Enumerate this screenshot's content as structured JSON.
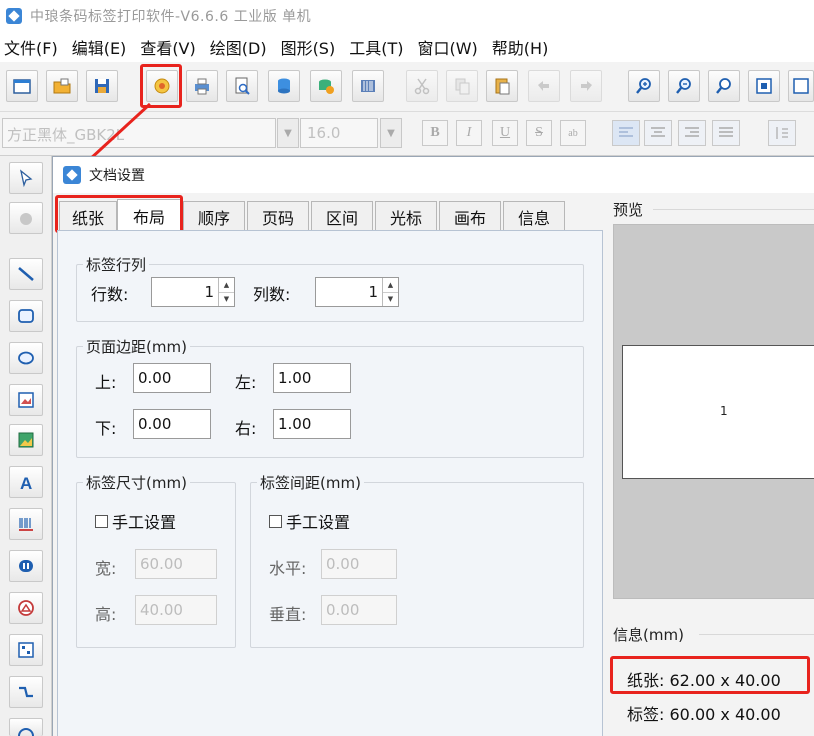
{
  "window": {
    "title": "中琅条码标签打印软件-V6.6.6 工业版 单机"
  },
  "menu": [
    "文件(F)",
    "编辑(E)",
    "查看(V)",
    "绘图(D)",
    "图形(S)",
    "工具(T)",
    "窗口(W)",
    "帮助(H)"
  ],
  "toolbar": {
    "buttons": [
      "new-icon",
      "open-icon",
      "save-icon",
      "document-settings-icon",
      "print-icon",
      "print-preview-icon",
      "database-icon",
      "data-source-icon",
      "barcode-icon",
      "cut-icon",
      "copy-icon",
      "paste-icon",
      "undo-icon",
      "redo-icon",
      "zoom-in-icon",
      "zoom-out-icon",
      "zoom-fit-icon",
      "zoom-page-icon",
      "more-icon"
    ],
    "highlighted": "document-settings-icon"
  },
  "font_toolbar": {
    "font_name": "方正黑体_GBK2L",
    "font_size": "16.0",
    "format_buttons": [
      "B",
      "I",
      "U",
      "S",
      "ab"
    ]
  },
  "dialog": {
    "title": "文档设置",
    "tabs": [
      "纸张",
      "布局",
      "顺序",
      "页码",
      "区间",
      "光标",
      "画布",
      "信息"
    ],
    "active_tab": "布局",
    "label_rows_cols": {
      "legend": "标签行列",
      "rows_label": "行数:",
      "rows_value": "1",
      "cols_label": "列数:",
      "cols_value": "1"
    },
    "page_margins": {
      "legend": "页面边距(mm)",
      "top_label": "上:",
      "top_value": "0.00",
      "left_label": "左:",
      "left_value": "1.00",
      "bottom_label": "下:",
      "bottom_value": "0.00",
      "right_label": "右:",
      "right_value": "1.00"
    },
    "label_size": {
      "legend": "标签尺寸(mm)",
      "manual_label": "手工设置",
      "width_label": "宽:",
      "width_value": "60.00",
      "height_label": "高:",
      "height_value": "40.00"
    },
    "label_spacing": {
      "legend": "标签间距(mm)",
      "manual_label": "手工设置",
      "horizontal_label": "水平:",
      "horizontal_value": "0.00",
      "vertical_label": "垂直:",
      "vertical_value": "0.00"
    },
    "preview": {
      "legend": "预览",
      "page_number": "1"
    },
    "info": {
      "legend": "信息(mm)",
      "paper_label": "纸张:",
      "paper_value": "62.00 x 40.00",
      "label_label": "标签:",
      "label_value": "60.00 x 40.00"
    }
  },
  "colors": {
    "highlight": "#e8231d",
    "accent": "#3b86d6"
  }
}
